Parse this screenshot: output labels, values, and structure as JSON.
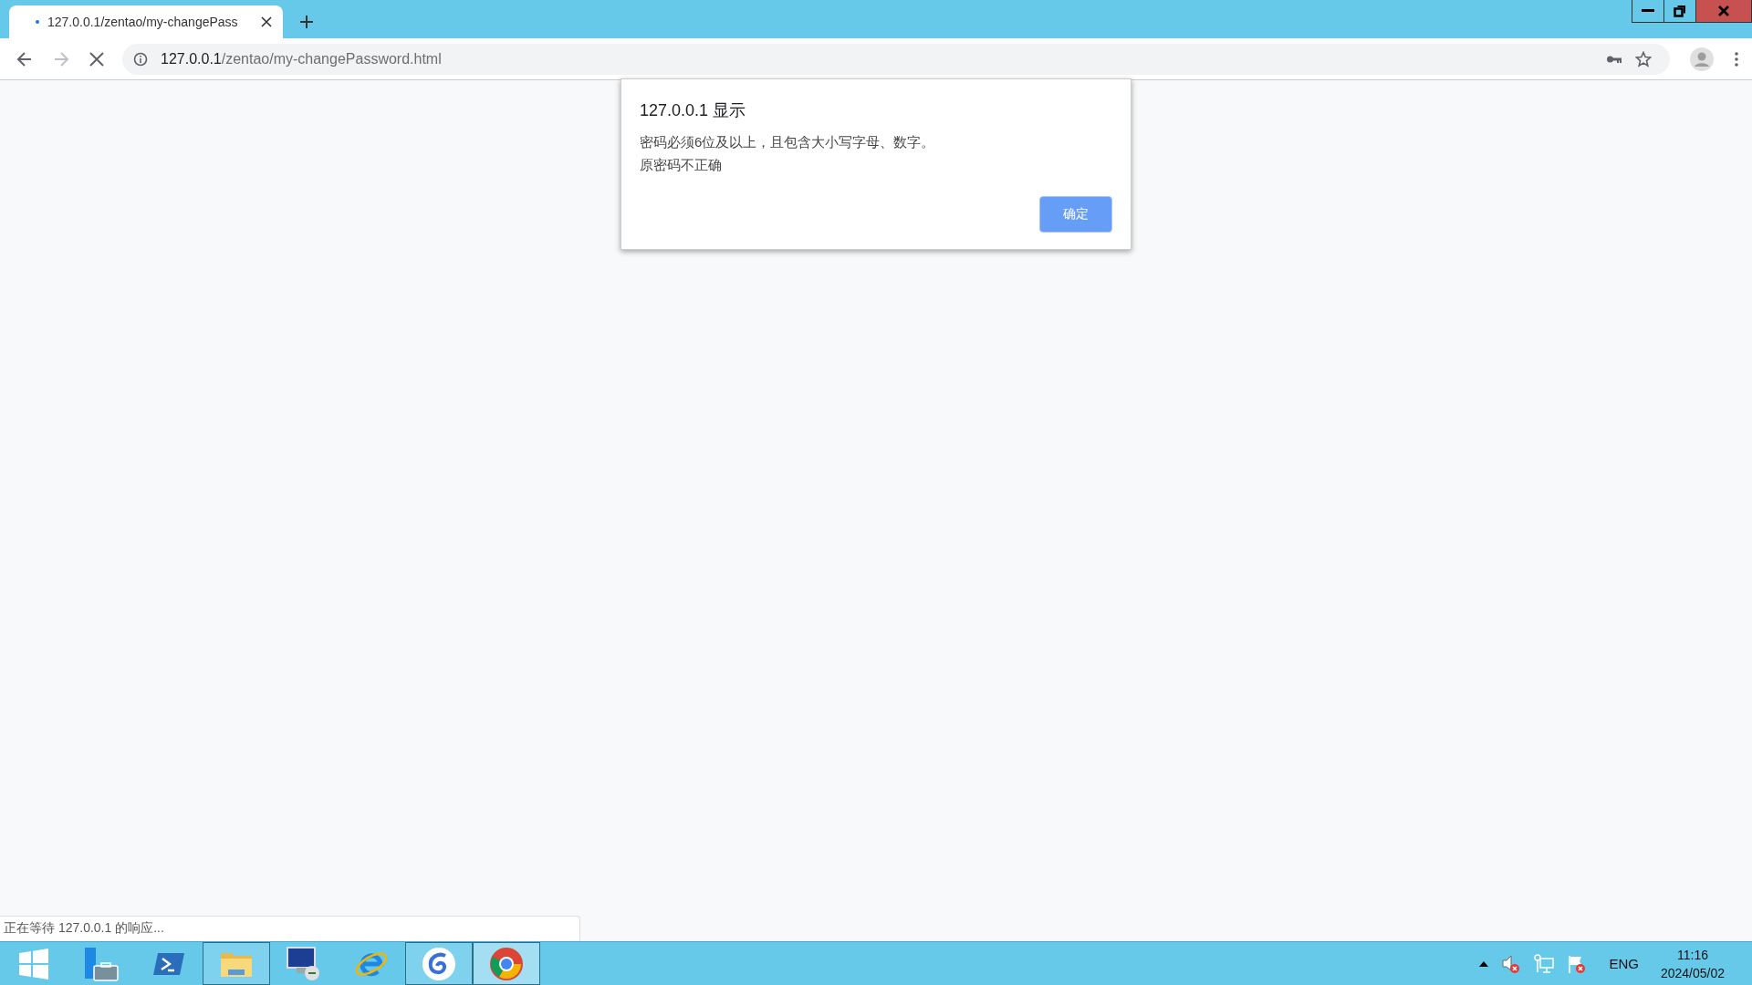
{
  "tabs": [
    {
      "title": "127.0.0.1/zentao/my-changePass",
      "loading": true,
      "selected": true
    }
  ],
  "address_bar": {
    "host": "127.0.0.1",
    "path": "/zentao/my-changePassword.html"
  },
  "dialog": {
    "title": "127.0.0.1 显示",
    "lines": [
      "密码必须6位及以上，且包含大小写字母、数字。",
      "原密码不正确"
    ],
    "button": "确定"
  },
  "status_bubble": "正在等待 127.0.0.1 的响应...",
  "taskbar": {
    "items": [
      {
        "kind": "start",
        "running": false,
        "selected": false
      },
      {
        "kind": "server",
        "running": false,
        "selected": false
      },
      {
        "kind": "shell",
        "running": false,
        "selected": false
      },
      {
        "kind": "folder",
        "running": true,
        "selected": false
      },
      {
        "kind": "remote",
        "running": false,
        "selected": false
      },
      {
        "kind": "ie",
        "running": false,
        "selected": false
      },
      {
        "kind": "spiral",
        "running": true,
        "selected": false
      },
      {
        "kind": "chrome",
        "running": true,
        "selected": true
      }
    ],
    "language": "ENG",
    "time": "11:16",
    "date": "2024/05/02"
  }
}
